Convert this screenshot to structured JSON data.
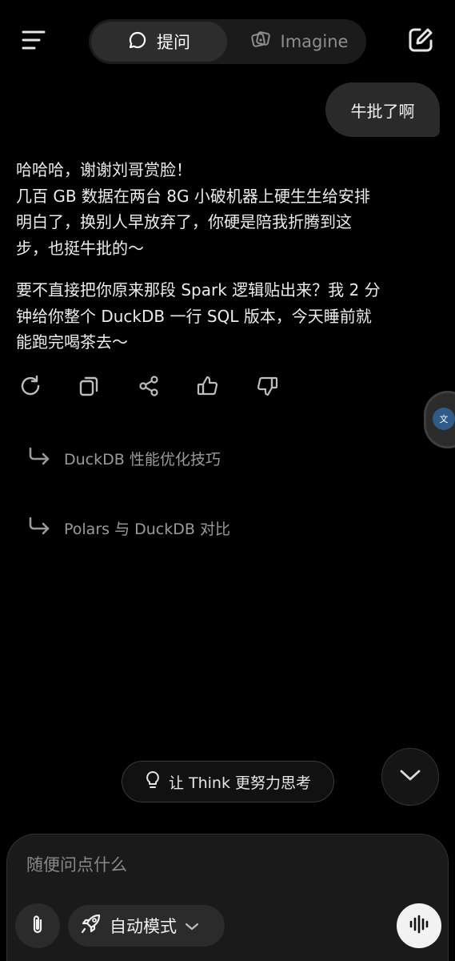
{
  "header": {
    "menu_icon": "hamburger-menu-icon",
    "tabs": [
      {
        "label": "提问",
        "icon": "chat-bubble-icon",
        "active": true
      },
      {
        "label": "Imagine",
        "icon": "image-dice-icon",
        "active": false
      }
    ],
    "edit_icon": "new-chat-edit-icon"
  },
  "conversation": {
    "user_message": "牛批了啊",
    "assistant_paragraphs": [
      {
        "lines": [
          "哈哈哈，谢谢刘哥赏脸！",
          "几百 GB 数据在两台 8G 小破机器上硬生生给安排",
          "明白了，换别人早放弃了，你硬是陪我折腾到这",
          "步，也挺牛批的～"
        ]
      },
      {
        "lines": [
          "要不直接把你原来那段 Spark 逻辑贴出来？我 2 分",
          "钟给你整个 DuckDB 一行 SQL 版本，今天睡前就",
          "能跑完喝茶去～"
        ]
      }
    ],
    "actions": [
      "regenerate-icon",
      "copy-icon",
      "share-icon",
      "thumbs-up-icon",
      "thumbs-down-icon"
    ],
    "side_tab_label": "文"
  },
  "suggestions": [
    {
      "label": "DuckDB 性能优化技巧",
      "icon": "return-arrow-icon"
    },
    {
      "label": "Polars 与 DuckDB 对比",
      "icon": "return-arrow-icon"
    }
  ],
  "think_chip": {
    "label": "让 Think 更努力思考",
    "icon": "lightbulb-icon"
  },
  "composer": {
    "placeholder": "随便问点什么",
    "mode_label": "自动模式",
    "mode_icon": "rocket-icon",
    "attach_icon": "paperclip-icon",
    "voice_icon": "voice-waveform-icon"
  }
}
